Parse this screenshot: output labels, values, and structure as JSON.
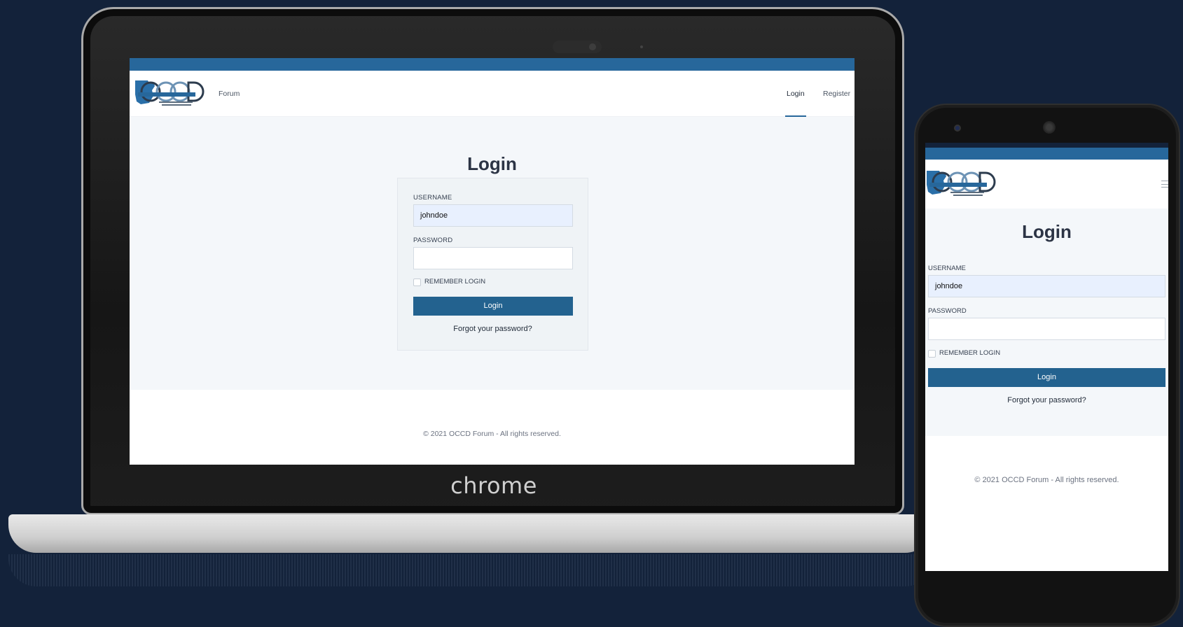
{
  "laptop": {
    "brand_label": "chrome"
  },
  "site": {
    "logo_name": "OCCD",
    "nav": {
      "forum": "Forum",
      "login": "Login",
      "register": "Register"
    },
    "login_form": {
      "heading": "Login",
      "username_label": "USERNAME",
      "username_value": "johndoe",
      "password_label": "PASSWORD",
      "password_value": "",
      "remember_label": "REMEMBER LOGIN",
      "remember_checked": false,
      "submit_label": "Login",
      "forgot_link": "Forgot your password?"
    },
    "footer": "© 2021 OCCD Forum - All rights reserved."
  },
  "colors": {
    "background": "#13223a",
    "brand_blue": "#27679b",
    "button_blue": "#23628f",
    "page_bg": "#f4f7fa",
    "autofill_bg": "#e8f0fe"
  },
  "icons": {
    "mobile_menu": "hamburger-menu-icon"
  }
}
